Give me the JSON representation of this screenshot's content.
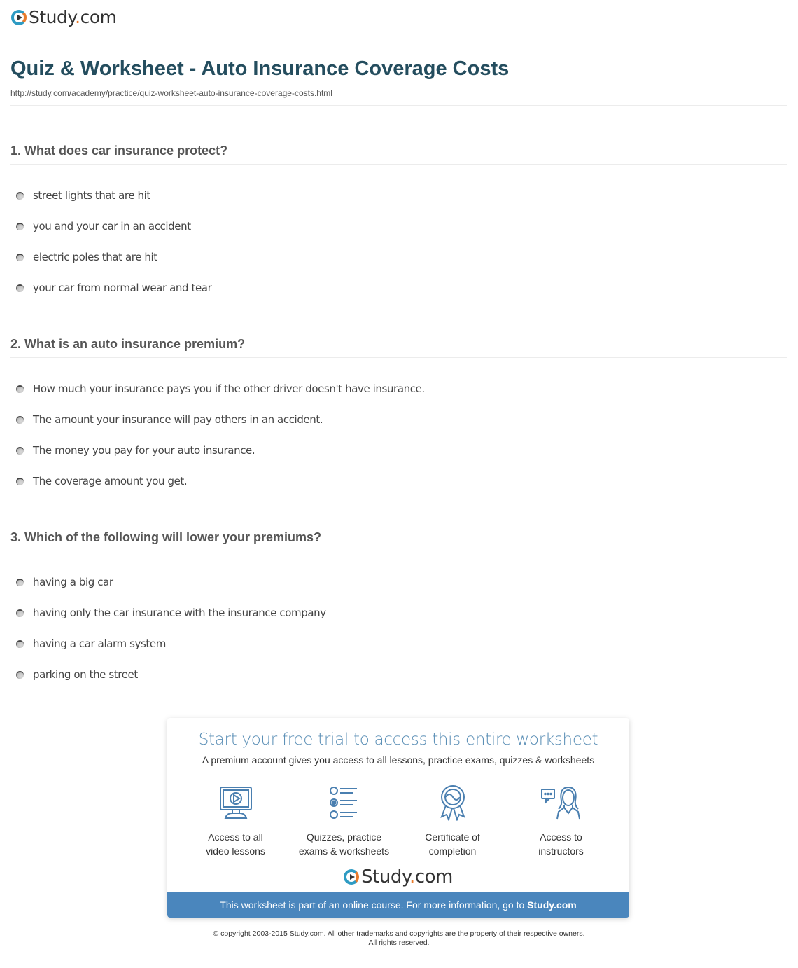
{
  "brand": {
    "logo_name": "Study",
    "logo_dot": ".",
    "logo_tld": "com",
    "accent_color": "#e87a2a",
    "primary_color": "#2e9bc3"
  },
  "header": {
    "title": "Quiz & Worksheet - Auto Insurance Coverage Costs",
    "url": "http://study.com/academy/practice/quiz-worksheet-auto-insurance-coverage-costs.html"
  },
  "questions": [
    {
      "title": "1. What does car insurance protect?",
      "answers": [
        "street lights that are hit",
        "you and your car in an accident",
        "electric poles that are hit",
        "your car from normal wear and tear"
      ]
    },
    {
      "title": "2. What is an auto insurance premium?",
      "answers": [
        "How much your insurance pays you if the other driver doesn't have insurance.",
        "The amount your insurance will pay others in an accident.",
        "The money you pay for your auto insurance.",
        "The coverage amount you get."
      ]
    },
    {
      "title": "3. Which of the following will lower your premiums?",
      "answers": [
        "having a big car",
        "having only the car insurance with the insurance company",
        "having a car alarm system",
        "parking on the street"
      ]
    }
  ],
  "cta": {
    "title": "Start your free trial to access this entire worksheet",
    "subtitle": "A premium account gives you access to all lessons, practice exams, quizzes & worksheets",
    "features": [
      {
        "icon": "video-monitor-icon",
        "label": "Access to all\nvideo lessons"
      },
      {
        "icon": "quiz-list-icon",
        "label": "Quizzes, practice\nexams & worksheets"
      },
      {
        "icon": "certificate-ribbon-icon",
        "label": "Certificate of\ncompletion"
      },
      {
        "icon": "instructor-chat-icon",
        "label": "Access to\ninstructors"
      }
    ],
    "banner_text": "This worksheet is part of an online course. For more information, go to ",
    "banner_link": "Study.com",
    "banner_color": "#4a86bd"
  },
  "footer": {
    "copyright_line1": "© copyright 2003-2015 Study.com. All other trademarks and copyrights are the property of their respective owners.",
    "copyright_line2": "All rights reserved."
  }
}
